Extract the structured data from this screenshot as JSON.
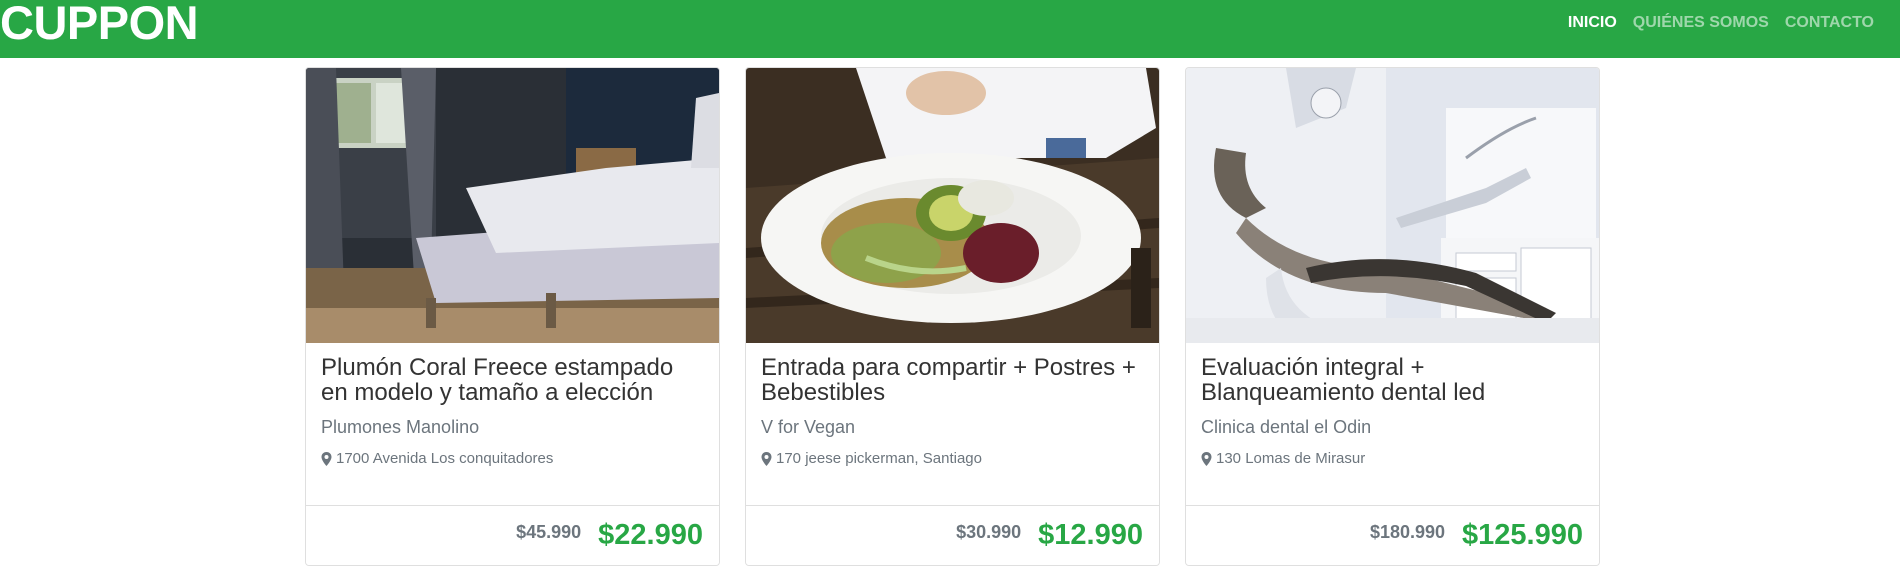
{
  "navbar": {
    "brand": "CUPPON",
    "links": [
      {
        "label": "INICIO",
        "active": true
      },
      {
        "label": "QUIÉNES SOMOS",
        "active": false
      },
      {
        "label": "CONTACTO",
        "active": false
      }
    ]
  },
  "colors": {
    "brand_green": "#28a745",
    "muted_text": "#6c757d"
  },
  "deals": [
    {
      "title": "Plumón Coral Freece estampado en modelo y tamaño a elección",
      "merchant": "Plumones Manolino",
      "address": "1700 Avenida Los conquitadores",
      "old_price": "$45.990",
      "new_price": "$22.990",
      "image": "bedroom-photo"
    },
    {
      "title": "Entrada para compartir + Postres + Bebestibles",
      "merchant": "V for Vegan",
      "address": "170 jeese pickerman, Santiago",
      "old_price": "$30.990",
      "new_price": "$12.990",
      "image": "vegan-salad-photo"
    },
    {
      "title": "Evaluación integral + Blanqueamiento dental led",
      "merchant": "Clinica dental el Odin",
      "address": "130 Lomas de Mirasur",
      "old_price": "$180.990",
      "new_price": "$125.990",
      "image": "dental-chair-photo"
    }
  ]
}
